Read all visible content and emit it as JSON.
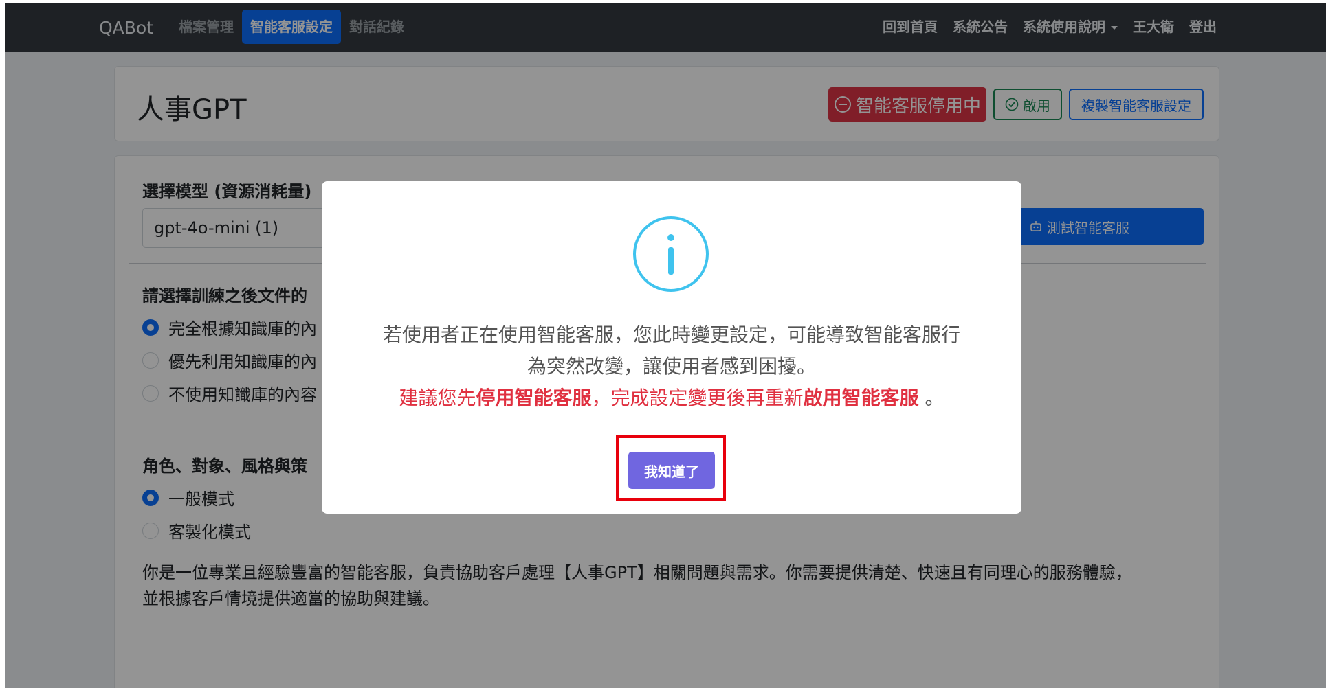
{
  "navbar": {
    "brand": "QABot",
    "left_items": [
      "檔案管理",
      "智能客服設定",
      "對話紀錄"
    ],
    "right_items": [
      "回到首頁",
      "系統公告",
      "系統使用說明",
      "王大衛",
      "登出"
    ]
  },
  "header": {
    "title": "人事GPT",
    "status_badge": "智能客服停用中",
    "enable_button": "啟用",
    "copy_button": "複製智能客服設定"
  },
  "settings": {
    "model_label": "選擇模型 (資源消耗量)",
    "model_value": "gpt-4o-mini (1)",
    "test_button": "測試智能客服",
    "knowledge_label": "請選擇訓練之後文件的",
    "knowledge_options": [
      "完全根據知識庫的內",
      "優先利用知識庫的內",
      "不使用知識庫的內容"
    ],
    "role_label": "角色、對象、風格與策",
    "mode_options": [
      "一般模式",
      "客製化模式"
    ],
    "prompt_line1": "你是一位專業且經驗豐富的智能客服，負責協助客戶處理【人事GPT】相關問題與需求。你需要提供清楚、快速且有同理心的服務體驗，",
    "prompt_line2": "並根據客戶情境提供適當的協助與建議。"
  },
  "modal": {
    "line1": "若使用者正在使用智能客服，您此時變更設定，可能導致智能客服行",
    "line2": "為突然改變，讓使用者感到困擾。",
    "line3_a": "建議您先",
    "line3_b": "停用智能客服",
    "line3_c": "，完成設定變更後再重新",
    "line3_d": "啟用智能客服",
    "line3_e": " 。",
    "ok_button": "我知道了"
  },
  "colors": {
    "primary": "#0d6efd",
    "danger": "#dc3545",
    "success": "#198754",
    "modal_button": "#7066e0",
    "info_icon": "#3fc3ee",
    "highlight_box": "#e8000c"
  }
}
